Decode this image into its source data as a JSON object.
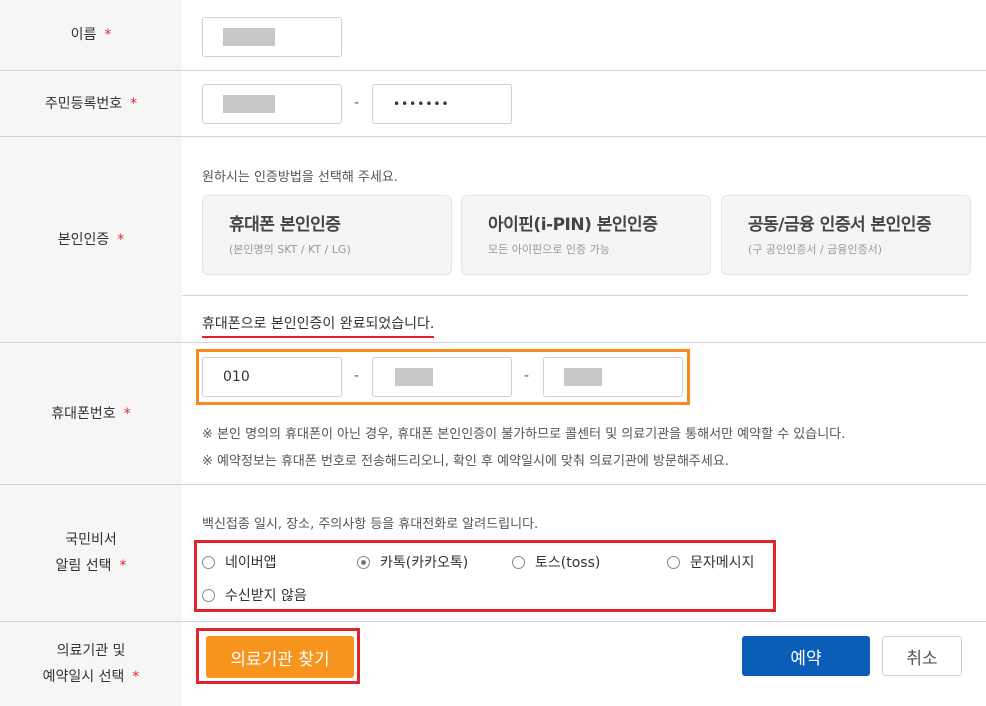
{
  "rows": {
    "name": {
      "label": "이름",
      "required_mark": "*"
    },
    "rrn": {
      "label": "주민등록번호",
      "required_mark": "*",
      "separator": "-",
      "back_masked": "•••••••"
    },
    "auth": {
      "label": "본인인증",
      "required_mark": "*",
      "guide": "원하시는 인증방법을 선택해 주세요.",
      "options": [
        {
          "title": "휴대폰 본인인증",
          "sub": "(본인명의 SKT / KT / LG)"
        },
        {
          "title": "아이핀(i-PIN) 본인인증",
          "sub": "모든 아이핀으로 인증 가능"
        },
        {
          "title": "공동/금융 인증서 본인인증",
          "sub": "(구 공인인증서 / 금융인증서)"
        }
      ],
      "done_message": "휴대폰으로 본인인증이 완료되었습니다."
    },
    "phone": {
      "label": "휴대폰번호",
      "required_mark": "*",
      "prefix": "010",
      "separator": "-",
      "notes": [
        "※ 본인 명의의 휴대폰이 아닌 경우, 휴대폰 본인인증이 불가하므로 콜센터 및 의료기관을 통해서만 예약할 수 있습니다.",
        "※ 예약정보는 휴대폰 번호로 전송해드리오니, 확인 후 예약일시에 맞춰 의료기관에 방문해주세요."
      ]
    },
    "notify": {
      "label_line1": "국민비서",
      "label_line2": "알림 선택",
      "required_mark": "*",
      "guide": "백신접종 일시, 장소, 주의사항 등을 휴대전화로 알려드립니다.",
      "options": [
        "네이버앱",
        "카톡(카카오톡)",
        "토스(toss)",
        "문자메시지",
        "수신받지 않음"
      ],
      "selected": "카톡(카카오톡)"
    },
    "hospital": {
      "label_line1": "의료기관 및",
      "label_line2": "예약일시 선택",
      "required_mark": "*",
      "find_button": "의료기관 찾기",
      "reserve_button": "예약",
      "cancel_button": "취소"
    }
  },
  "colors": {
    "required": "#e0242d",
    "highlight_orange": "#f7891e",
    "highlight_red": "#e0242d",
    "find_button": "#f7941d",
    "reserve_button": "#0a5eb7"
  }
}
